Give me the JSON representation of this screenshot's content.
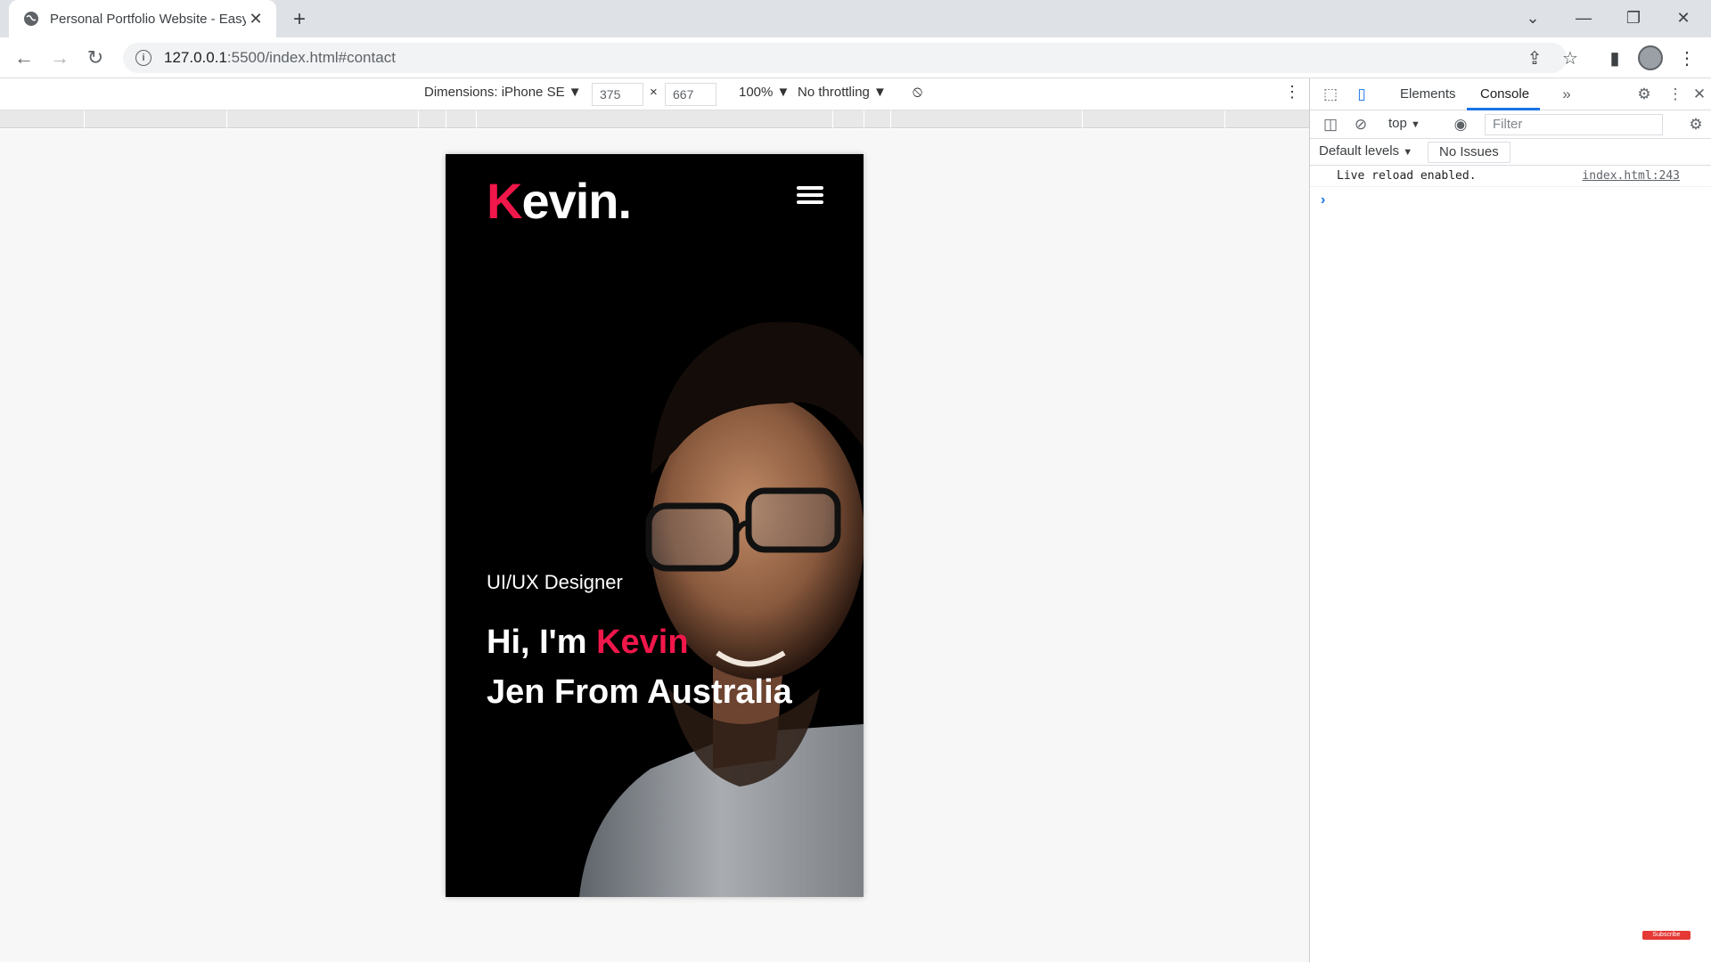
{
  "browser": {
    "tab_title": "Personal Portfolio Website - Easy",
    "url_host": "127.0.0.1",
    "url_path": ":5500/index.html#contact"
  },
  "device_toolbar": {
    "dimensions_label": "Dimensions: iPhone SE",
    "width": "375",
    "times": "×",
    "height": "667",
    "zoom": "100%",
    "throttling": "No throttling"
  },
  "page": {
    "logo_first": "K",
    "logo_rest": "evin.",
    "subtitle": "UI/UX Designer",
    "headline_prefix": "Hi, I'm ",
    "headline_name": "Kevin",
    "headline_line2": "Jen From Australia",
    "accent_color": "#f0174a"
  },
  "devtools": {
    "tabs": [
      "Elements",
      "Console"
    ],
    "context": "top",
    "filter_placeholder": "Filter",
    "levels": "Default levels",
    "issues": "No Issues",
    "console_message": "Live reload enabled.",
    "console_source": "index.html:243"
  },
  "badge": "Subscribe"
}
